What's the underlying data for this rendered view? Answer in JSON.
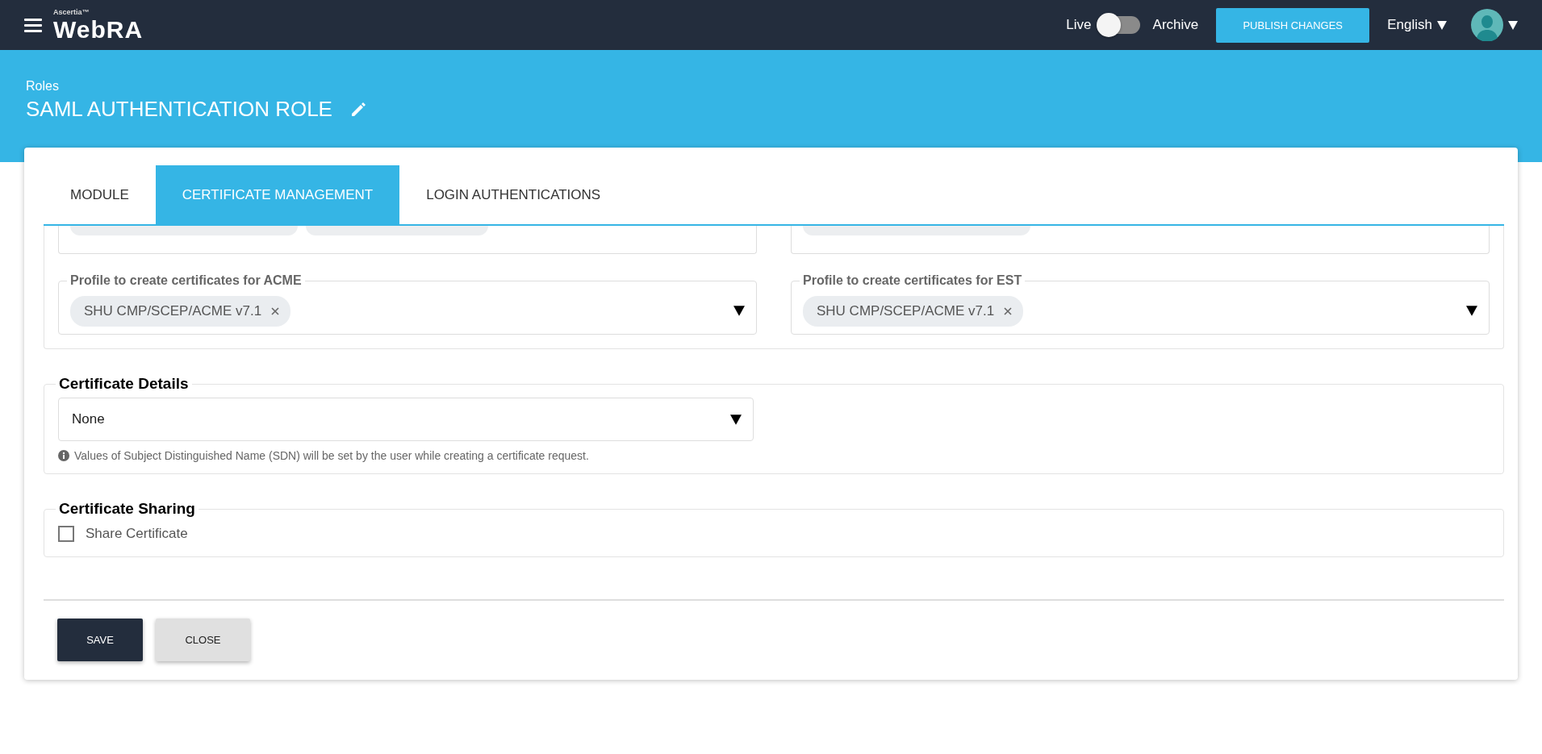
{
  "header": {
    "brand": "Ascertia™",
    "logo": "WebRA",
    "toggle": {
      "left_label": "Live",
      "right_label": "Archive",
      "on": false
    },
    "publish_button": "PUBLISH CHANGES",
    "language": "English"
  },
  "page": {
    "breadcrumb": "Roles",
    "title": "SAML AUTHENTICATION ROLE"
  },
  "tabs": [
    {
      "label": "MODULE",
      "selected": false
    },
    {
      "label": "CERTIFICATE MANAGEMENT",
      "selected": true
    },
    {
      "label": "LOGIN AUTHENTICATIONS",
      "selected": false
    }
  ],
  "profile_fields": [
    {
      "label": "Profile to create certificates for ACME",
      "tags": [
        "SHU CMP/SCEP/ACME v7.1"
      ]
    },
    {
      "label": "Profile to create certificates for EST",
      "tags": [
        "SHU CMP/SCEP/ACME v7.1"
      ]
    }
  ],
  "certificate_details": {
    "heading": "Certificate Details",
    "select_value": "None",
    "info": "Values of Subject Distinguished Name (SDN) will be set by the user while creating a certificate request."
  },
  "certificate_sharing": {
    "heading": "Certificate Sharing",
    "options": [
      {
        "label": "Share Certificate",
        "checked": false
      }
    ]
  },
  "buttons": [
    {
      "label": "SAVE",
      "kind": "primary"
    },
    {
      "label": "CLOSE",
      "kind": "secondary"
    }
  ]
}
